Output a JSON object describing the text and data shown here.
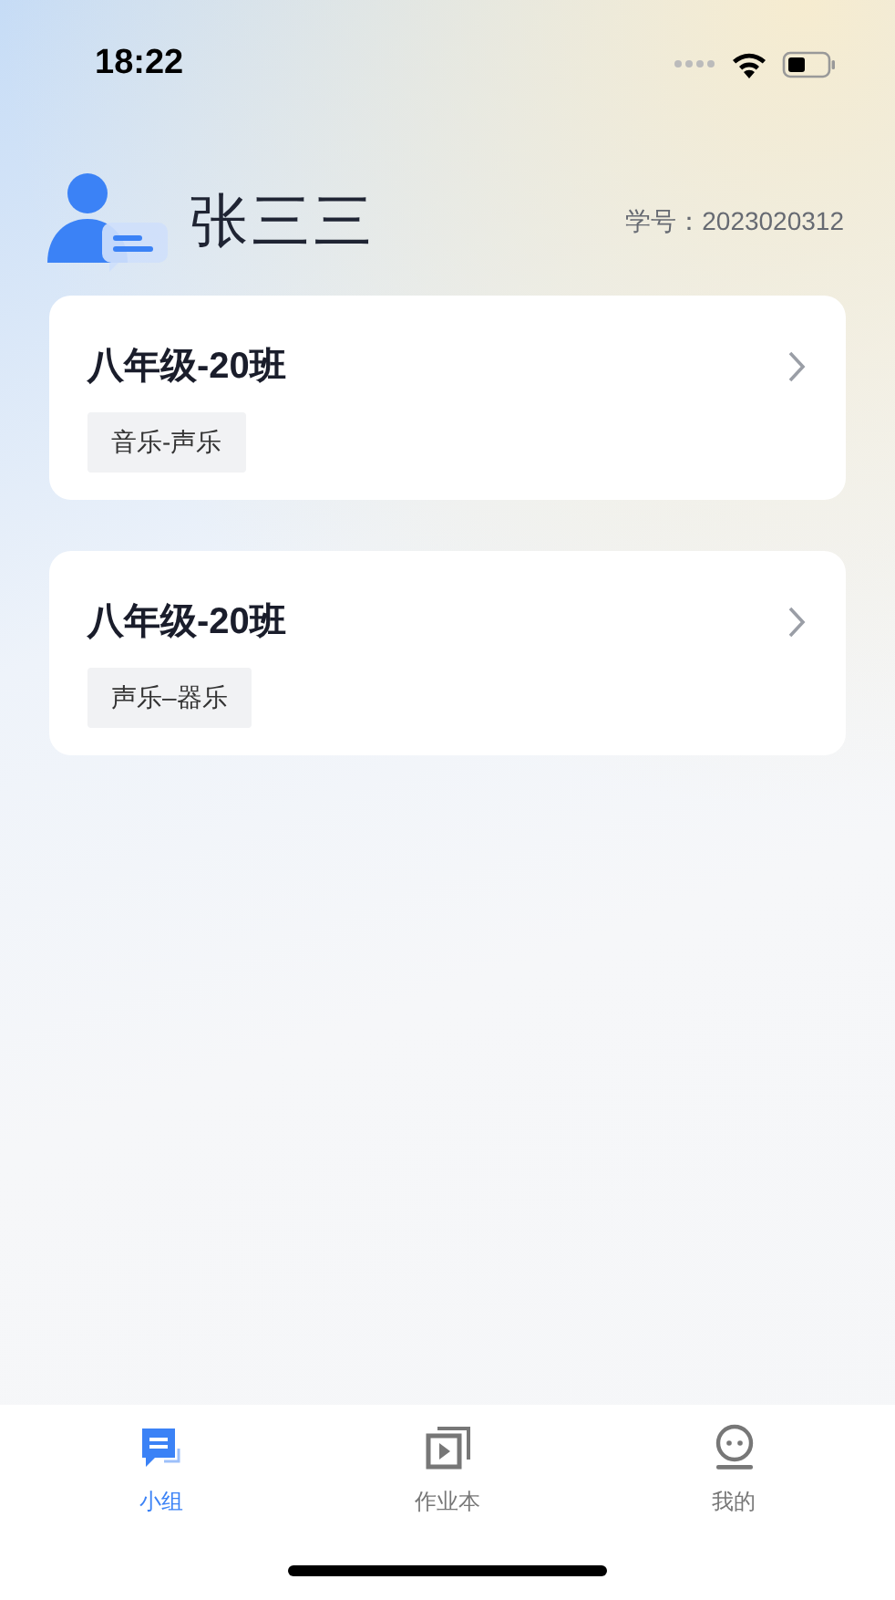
{
  "status_bar": {
    "time": "18:22"
  },
  "profile": {
    "name": "张三三",
    "student_id_label": "学号：2023020312"
  },
  "classes": [
    {
      "title": "八年级-20班",
      "tag": "音乐-声乐"
    },
    {
      "title": "八年级-20班",
      "tag": "声乐–器乐"
    }
  ],
  "tab_bar": [
    {
      "kind": "group",
      "label": "小组",
      "selected": true
    },
    {
      "kind": "homework",
      "label": "作业本",
      "selected": false
    },
    {
      "kind": "mine",
      "label": "我的",
      "selected": false
    }
  ]
}
